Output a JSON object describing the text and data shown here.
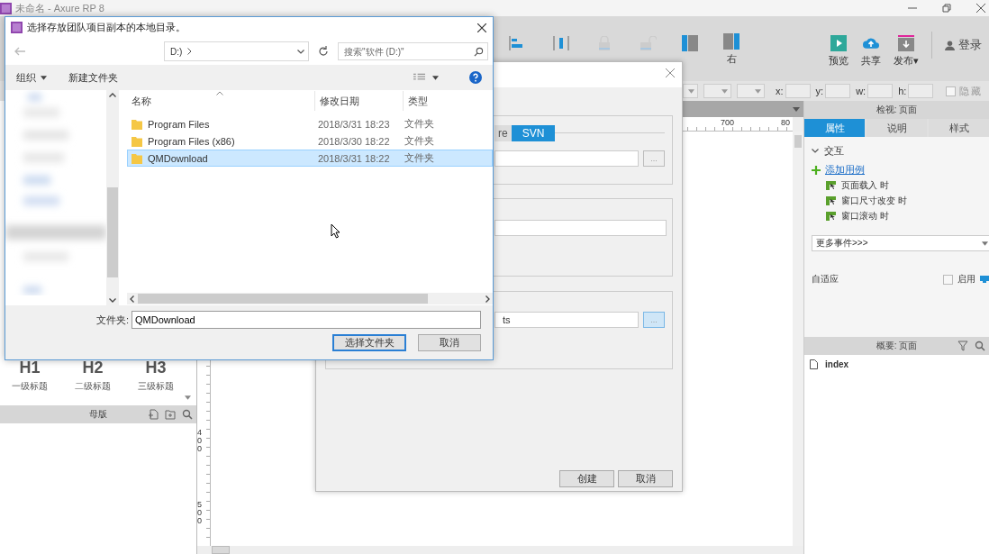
{
  "app": {
    "title": "未命名 - Axure RP 8"
  },
  "toolbar": {
    "align_right_label": "右",
    "actions": [
      {
        "label": "预览",
        "kind": "preview"
      },
      {
        "label": "共享",
        "kind": "share"
      },
      {
        "label": "发布▾",
        "kind": "publish"
      }
    ],
    "login": "登录"
  },
  "format_bar": {
    "fields": [
      {
        "label": "x:"
      },
      {
        "label": "y:"
      },
      {
        "label": "w:"
      },
      {
        "label": "h:"
      }
    ],
    "hide": {
      "label": "隐藏",
      "checked": false
    }
  },
  "rulers": {
    "horizontal": [
      "700",
      "80"
    ],
    "vertical": [
      "400",
      "500"
    ]
  },
  "left_panel": {
    "headings": [
      {
        "sample": "H1",
        "label": "一级标题"
      },
      {
        "sample": "H2",
        "label": "二级标题"
      },
      {
        "sample": "H3",
        "label": "三级标题"
      }
    ],
    "masters_title": "母版"
  },
  "right_panel": {
    "inspector_title": "检视: 页面",
    "tabs": [
      {
        "label": "属性",
        "selected": true
      },
      {
        "label": "说明",
        "selected": false
      },
      {
        "label": "样式",
        "selected": false
      }
    ],
    "section": {
      "label": "交互",
      "expanded": true
    },
    "add_case": "添加用例",
    "events": [
      "页面载入 时",
      "窗口尺寸改变 时",
      "窗口滚动 时"
    ],
    "more_events": "更多事件>>>",
    "adaptive": {
      "label": "自适应",
      "enable_label": "启用",
      "checked": false
    },
    "outline_title": "概要: 页面",
    "pages": [
      "index"
    ]
  },
  "team_dialog": {
    "tabs": [
      {
        "label": "re",
        "selected": false
      },
      {
        "label": "SVN",
        "selected": true
      }
    ],
    "browse": "...",
    "field3_value": "ts",
    "buttons": [
      "创建",
      "取消"
    ]
  },
  "file_dialog": {
    "title": "选择存放团队项目副本的本地目录。",
    "address": "D:)",
    "search_placeholder": "搜索\"软件 (D:)\"",
    "organize": "组织",
    "new_folder": "新建文件夹",
    "columns": [
      "名称",
      "修改日期",
      "类型"
    ],
    "rows": [
      {
        "name": "Program Files",
        "date": "2018/3/31 18:23",
        "type": "文件夹",
        "selected": false
      },
      {
        "name": "Program Files (x86)",
        "date": "2018/3/30 18:22",
        "type": "文件夹",
        "selected": false
      },
      {
        "name": "QMDownload",
        "date": "2018/3/31 18:22",
        "type": "文件夹",
        "selected": true
      }
    ],
    "folder_label": "文件夹:",
    "folder_value": "QMDownload",
    "buttons": [
      "选择文件夹",
      "取消"
    ]
  }
}
